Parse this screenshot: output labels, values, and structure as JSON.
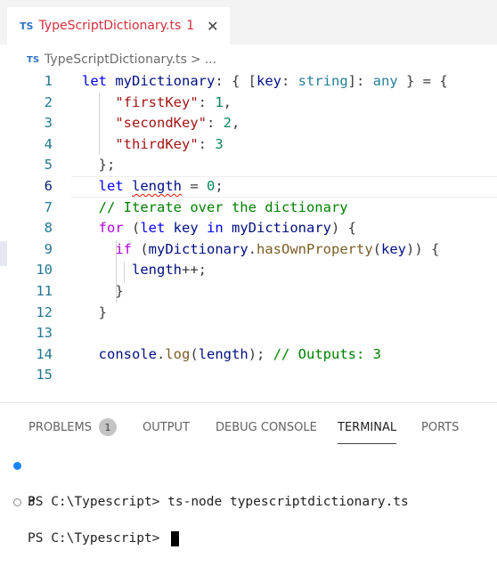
{
  "tab": {
    "lang_badge": "TS",
    "filename": "TypeScriptDictionary.ts",
    "problem_count": "1",
    "close_glyph": "✕"
  },
  "breadcrumb": {
    "lang_badge": "TS",
    "filename": "TypeScriptDictionary.ts",
    "separator": ">",
    "ellipsis": "..."
  },
  "editor": {
    "active_line": 6,
    "lines": [
      {
        "n": "1",
        "tokens": [
          [
            "kw",
            "let "
          ],
          [
            "var",
            "myDictionary"
          ],
          [
            "pn",
            ": { ["
          ],
          [
            "var",
            "key"
          ],
          [
            "pn",
            ": "
          ],
          [
            "type",
            "string"
          ],
          [
            "pn",
            "]: "
          ],
          [
            "type",
            "any"
          ],
          [
            "pn",
            " } = {"
          ]
        ]
      },
      {
        "n": "2",
        "tokens": [
          [
            "pn",
            "    "
          ],
          [
            "str",
            "\"firstKey\""
          ],
          [
            "pn",
            ": "
          ],
          [
            "num",
            "1"
          ],
          [
            "pn",
            ","
          ]
        ]
      },
      {
        "n": "3",
        "tokens": [
          [
            "pn",
            "    "
          ],
          [
            "str",
            "\"secondKey\""
          ],
          [
            "pn",
            ": "
          ],
          [
            "num",
            "2"
          ],
          [
            "pn",
            ","
          ]
        ]
      },
      {
        "n": "4",
        "tokens": [
          [
            "pn",
            "    "
          ],
          [
            "str",
            "\"thirdKey\""
          ],
          [
            "pn",
            ": "
          ],
          [
            "num",
            "3"
          ]
        ]
      },
      {
        "n": "5",
        "tokens": [
          [
            "pn",
            "  };"
          ]
        ]
      },
      {
        "n": "6",
        "tokens": [
          [
            "kw",
            "  let "
          ],
          [
            "var squig",
            "length"
          ],
          [
            "pn",
            " = "
          ],
          [
            "num",
            "0"
          ],
          [
            "pn",
            ";"
          ]
        ]
      },
      {
        "n": "7",
        "tokens": [
          [
            "cmt",
            "  // Iterate over the dictionary"
          ]
        ]
      },
      {
        "n": "8",
        "tokens": [
          [
            "kw2",
            "  for"
          ],
          [
            "pn",
            " ("
          ],
          [
            "kw",
            "let "
          ],
          [
            "var",
            "key"
          ],
          [
            "kw",
            " in "
          ],
          [
            "var",
            "myDictionary"
          ],
          [
            "pn",
            ") {"
          ]
        ]
      },
      {
        "n": "9",
        "tokens": [
          [
            "kw2",
            "    if"
          ],
          [
            "pn",
            " ("
          ],
          [
            "var",
            "myDictionary"
          ],
          [
            "pn",
            "."
          ],
          [
            "fn",
            "hasOwnProperty"
          ],
          [
            "pn",
            "("
          ],
          [
            "var",
            "key"
          ],
          [
            "pn",
            ")) {"
          ]
        ]
      },
      {
        "n": "10",
        "tokens": [
          [
            "var",
            "      length"
          ],
          [
            "pn",
            "++;"
          ]
        ]
      },
      {
        "n": "11",
        "tokens": [
          [
            "pn",
            "    }"
          ]
        ]
      },
      {
        "n": "12",
        "tokens": [
          [
            "pn",
            "  }"
          ]
        ]
      },
      {
        "n": "13",
        "tokens": []
      },
      {
        "n": "14",
        "tokens": [
          [
            "var",
            "  console"
          ],
          [
            "pn",
            "."
          ],
          [
            "fn",
            "log"
          ],
          [
            "pn",
            "("
          ],
          [
            "var",
            "length"
          ],
          [
            "pn",
            "); "
          ],
          [
            "cmt",
            "// Outputs: 3"
          ]
        ]
      },
      {
        "n": "15",
        "tokens": []
      }
    ]
  },
  "panel": {
    "tabs": [
      "PROBLEMS",
      "OUTPUT",
      "DEBUG CONSOLE",
      "TERMINAL",
      "PORTS"
    ],
    "problems_badge": "1",
    "active_tab": "TERMINAL"
  },
  "terminal": {
    "line1": "PS C:\\Typescript> ts-node typescriptdictionary.ts",
    "line2": "3",
    "line3": "PS C:\\Typescript> "
  },
  "colors": {
    "accent": "#1a85ff",
    "error": "#e51400",
    "keyword": "#0000ff",
    "string": "#a31515"
  }
}
